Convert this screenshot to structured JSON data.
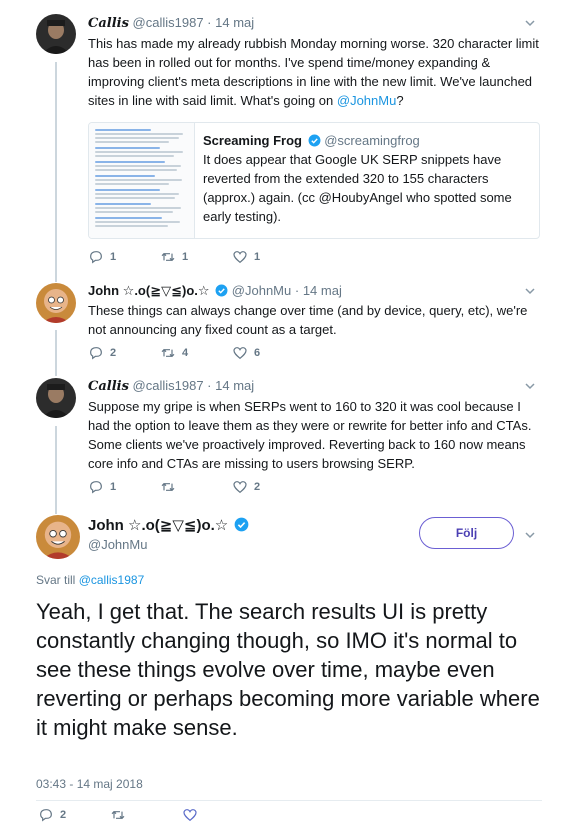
{
  "colors": {
    "link": "#1b95e0",
    "text": "#14171a",
    "muted": "#657786",
    "follow": "#6b5fd3",
    "like_icon": "#5b6cc9"
  },
  "tweets": [
    {
      "name": "Callis",
      "handle": "@callis1987",
      "sep": "·",
      "time": "14 maj",
      "text": "This has made my already rubbish Monday morning worse. 320 character limit has been in rolled out for months. I've spend time/money expanding & improving client's meta descriptions in line with the new limit. We've launched sites in line with said limit. What's going on ",
      "mention": "@JohnMu",
      "text_end": "?",
      "quote": {
        "name": "Screaming Frog",
        "handle": "@screamingfrog",
        "text": "It does appear that Google UK SERP snippets have reverted from the extended 320 to 155 characters (approx.) again. (cc @HoubyAngel who spotted some early testing)."
      },
      "replies": "1",
      "retweets": "1",
      "likes": "1"
    },
    {
      "name": "John ☆.o(≧▽≦)o.☆",
      "handle": "@JohnMu",
      "sep": "·",
      "time": "14 maj",
      "text": "These things can always change over time (and by device, query, etc), we're not announcing any fixed count as a target.",
      "replies": "2",
      "retweets": "4",
      "likes": "6"
    },
    {
      "name": "Callis",
      "handle": "@callis1987",
      "sep": "·",
      "time": "14 maj",
      "text": "Suppose my gripe is when SERPs went to 160 to 320 it was cool because I had the option to leave them as they were or rewrite for better info and CTAs. Some clients we've proactively improved. Reverting back to 160 now means core info and CTAs are missing to users browsing SERP.",
      "replies": "1",
      "retweets": "",
      "likes": "2"
    }
  ],
  "main": {
    "name": "John ☆.o(≧▽≦)o.☆",
    "handle": "@JohnMu",
    "follow_label": "Följ",
    "reply_prefix": "Svar till ",
    "reply_to": "@callis1987",
    "text": "Yeah, I get that. The search results UI is pretty constantly changing though, so IMO it's normal to see these things evolve over time, maybe even reverting or perhaps becoming more variable where it might make sense.",
    "timestamp": "03:43 - 14 maj 2018",
    "replies": "2",
    "retweets": "",
    "likes": ""
  },
  "icons": {
    "reply": "reply-icon",
    "retweet": "retweet-icon",
    "like": "heart-icon",
    "verified": "verified-badge-icon",
    "caret": "chevron-down-icon"
  }
}
